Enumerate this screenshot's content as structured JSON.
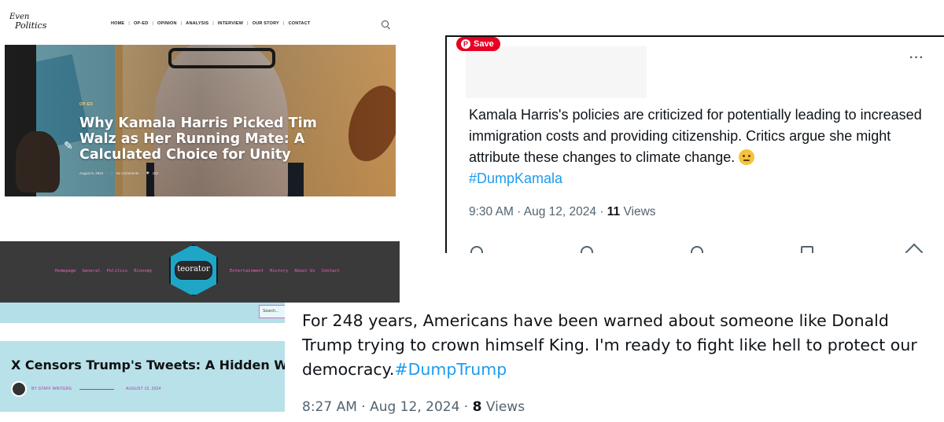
{
  "panel_a": {
    "logo_line1": "Even",
    "logo_line2": "Politics",
    "nav": [
      "HOME",
      "OP-ED",
      "OPINION",
      "ANALYSIS",
      "INTERVIEW",
      "OUR STORY",
      "CONTACT"
    ],
    "category": "OP-ED",
    "title": "Why Kamala Harris Picked Tim Walz as Her Running Mate: A Calculated Choice for Unity",
    "date": "August 8, 2024",
    "comments": "No Comments",
    "views": "152"
  },
  "panel_b": {
    "save_label": "Save",
    "text": "Kamala Harris's policies are criticized for potentially leading to increased immigration costs and providing citizenship. Critics argue she might attribute these changes to climate change.",
    "hashtag": "#DumpKamala",
    "time": "9:30 AM · Aug 12, 2024 · ",
    "views_count": "11",
    "views_label": " Views"
  },
  "panel_c": {
    "nav_left": [
      "Homepage",
      "General",
      "Politics",
      "Economy"
    ],
    "nav_right": [
      "Entertainment",
      "History",
      "About Us",
      "Contact"
    ],
    "logo": "teorator",
    "search_placeholder": "Search...",
    "article_title": "X Censors Trump's Tweets: A Hidden War on",
    "author": "BY STAFF WRITERS",
    "date": "AUGUST 15, 2024"
  },
  "panel_d": {
    "text": "For 248 years, Americans have been warned about someone like Donald Trump trying to crown himself King. I'm ready to fight like hell to protect our democracy.",
    "hashtag": "#DumpTrump",
    "time": "8:27 AM · Aug 12, 2024 · ",
    "views_count": "8",
    "views_label": " Views"
  },
  "colors": {
    "tweet_link": "#1d9bf0",
    "pinterest_red": "#e60023",
    "teorator_pink": "#ff59c5",
    "teorator_light_blue": "#b8e1ea"
  }
}
